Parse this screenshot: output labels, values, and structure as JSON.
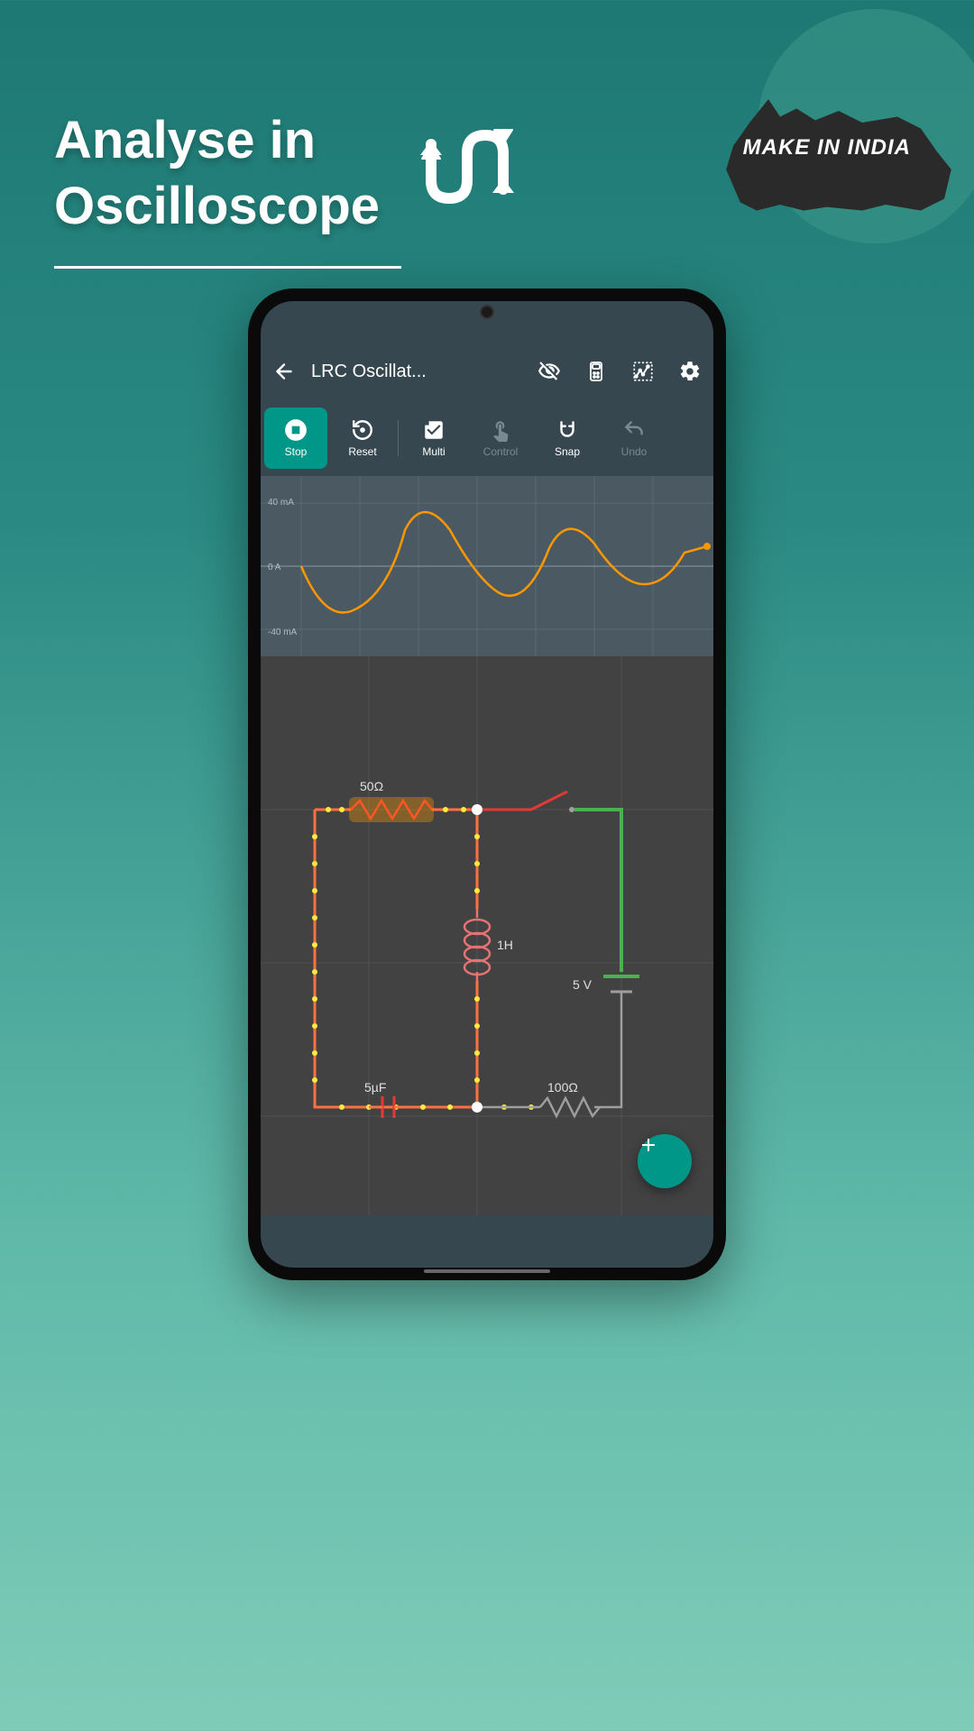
{
  "promo": {
    "title_line1": "Analyse in",
    "title_line2": "Oscilloscope",
    "make_in_india": "MAKE IN INDIA"
  },
  "app": {
    "title": "LRC Oscillat..."
  },
  "toolbar": {
    "stop": "Stop",
    "reset": "Reset",
    "multi": "Multi",
    "control": "Control",
    "snap": "Snap",
    "undo": "Undo"
  },
  "scope": {
    "top": "40 mA",
    "mid": "0 A",
    "bot": "-40 mA"
  },
  "circuit": {
    "resistor1": "50Ω",
    "inductor": "1H",
    "voltage": "5 V",
    "capacitor": "5µF",
    "resistor2": "100Ω"
  },
  "colors": {
    "accent": "#009688"
  }
}
